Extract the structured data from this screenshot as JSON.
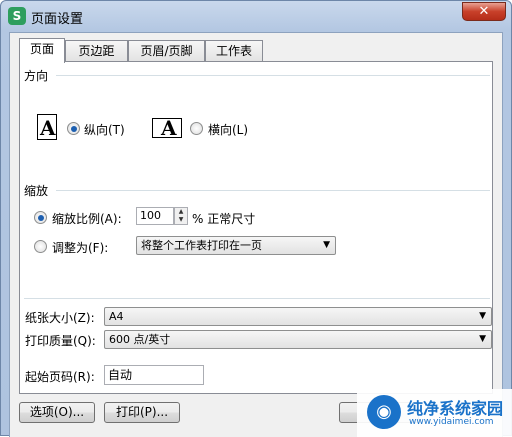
{
  "window": {
    "title": "页面设置",
    "app_icon": "S",
    "close_symbol": "✕"
  },
  "tabs": [
    {
      "label": "页面",
      "active": true
    },
    {
      "label": "页边距",
      "active": false
    },
    {
      "label": "页眉/页脚",
      "active": false
    },
    {
      "label": "工作表",
      "active": false
    }
  ],
  "orientation": {
    "group_label": "方向",
    "icon_glyph": "A",
    "portrait_label": "纵向(T)",
    "landscape_label": "横向(L)",
    "selected": "portrait"
  },
  "scaling": {
    "group_label": "缩放",
    "adjust_label": "缩放比例(A):",
    "adjust_value": "100",
    "adjust_suffix": "% 正常尺寸",
    "fit_label": "调整为(F):",
    "fit_option": "将整个工作表打印在一页",
    "selected": "adjust"
  },
  "paper": {
    "size_label": "纸张大小(Z):",
    "size_value": "A4",
    "quality_label": "打印质量(Q):",
    "quality_value": "600 点/英寸",
    "first_page_label": "起始页码(R):",
    "first_page_value": "自动"
  },
  "buttons": {
    "options": "选项(O)...",
    "print": "打印(P)..."
  },
  "watermark": {
    "title": "纯净系统家园",
    "url": "www.yidaimei.com"
  }
}
